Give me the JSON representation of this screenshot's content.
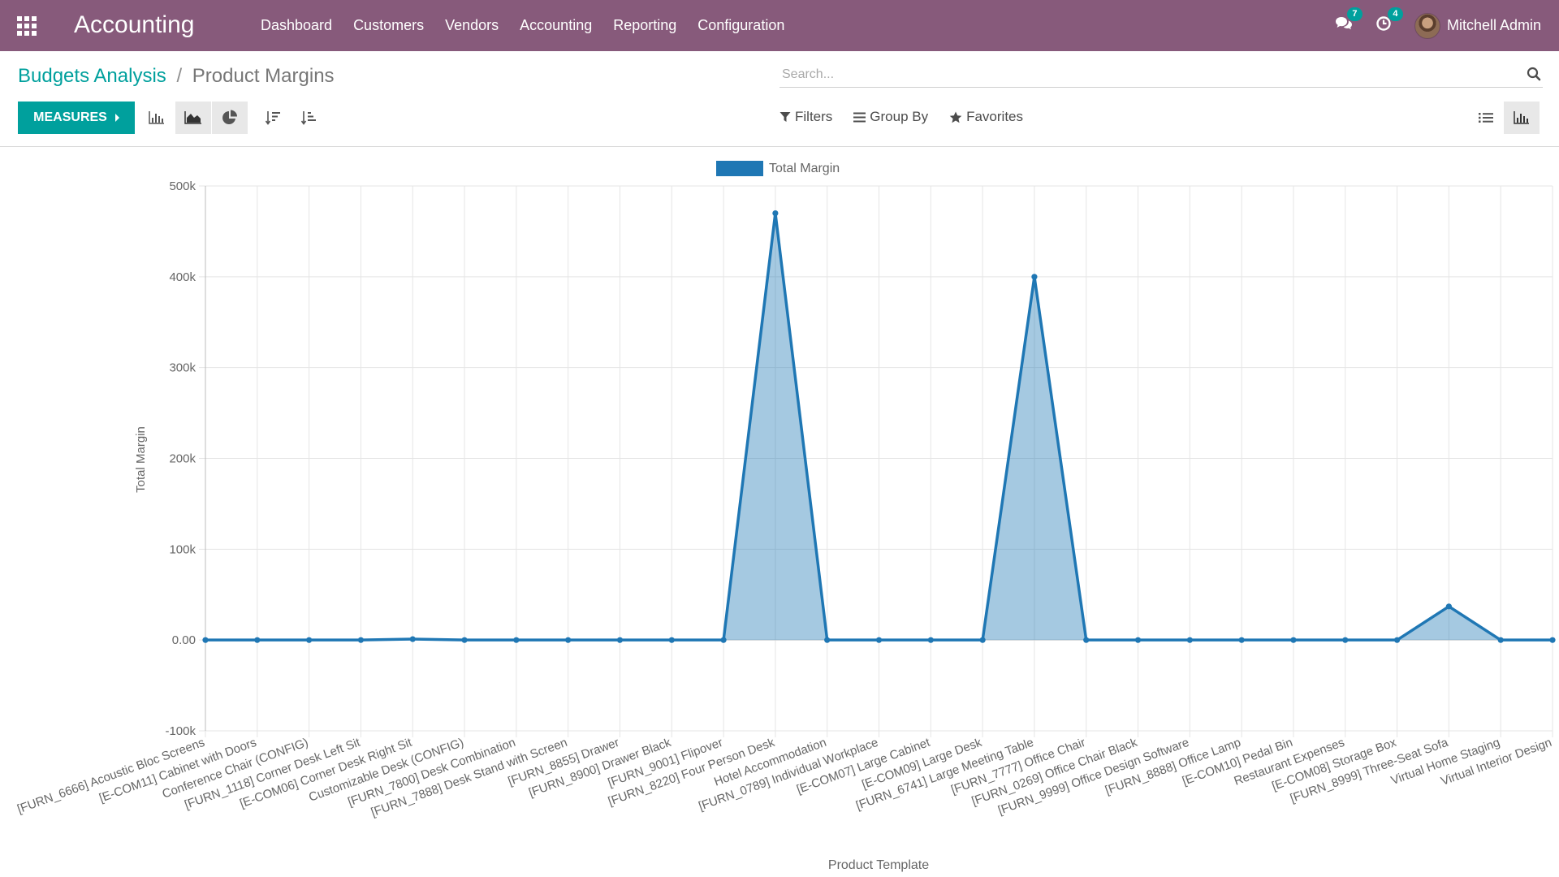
{
  "navbar": {
    "app_title": "Accounting",
    "menu": [
      "Dashboard",
      "Customers",
      "Vendors",
      "Accounting",
      "Reporting",
      "Configuration"
    ],
    "messages_count": "7",
    "activities_count": "4",
    "user_name": "Mitchell Admin"
  },
  "breadcrumb": {
    "parent": "Budgets Analysis",
    "separator": "/",
    "current": "Product Margins"
  },
  "search": {
    "placeholder": "Search..."
  },
  "toolbar": {
    "measures_label": "MEASURES"
  },
  "filters": {
    "filters_label": "Filters",
    "group_by_label": "Group By",
    "favorites_label": "Favorites"
  },
  "colors": {
    "navbar": "#875a7b",
    "accent": "#00a09d",
    "series": "#1f77b4"
  },
  "chart_data": {
    "type": "area",
    "legend": [
      "Total Margin"
    ],
    "legend_position": "top-center",
    "xlabel": "Product Template",
    "ylabel": "Total Margin",
    "ylim": [
      -100000,
      500000
    ],
    "yticks": [
      "-100k",
      "0.00",
      "100k",
      "200k",
      "300k",
      "400k",
      "500k"
    ],
    "ytick_values": [
      -100000,
      0,
      100000,
      200000,
      300000,
      400000,
      500000
    ],
    "grid": true,
    "categories": [
      "[FURN_6666] Acoustic Bloc Screens",
      "[E-COM11] Cabinet with Doors",
      "Conference Chair (CONFIG)",
      "[FURN_1118] Corner Desk Left Sit",
      "[E-COM06] Corner Desk Right Sit",
      "Customizable Desk (CONFIG)",
      "[FURN_7800] Desk Combination",
      "[FURN_7888] Desk Stand with Screen",
      "[FURN_8855] Drawer",
      "[FURN_8900] Drawer Black",
      "[FURN_9001] Flipover",
      "[FURN_8220] Four Person Desk",
      "Hotel Accommodation",
      "[FURN_0789] Individual Workplace",
      "[E-COM07] Large Cabinet",
      "[E-COM09] Large Desk",
      "[FURN_6741] Large Meeting Table",
      "[FURN_7777] Office Chair",
      "[FURN_0269] Office Chair Black",
      "[FURN_9999] Office Design Software",
      "[FURN_8888] Office Lamp",
      "[E-COM10] Pedal Bin",
      "Restaurant Expenses",
      "[E-COM08] Storage Box",
      "[FURN_8999] Three-Seat Sofa",
      "Virtual Home Staging",
      "Virtual Interior Design"
    ],
    "series": [
      {
        "name": "Total Margin",
        "values": [
          0,
          0,
          0,
          0,
          1000,
          0,
          0,
          0,
          0,
          0,
          0,
          470000,
          0,
          0,
          0,
          0,
          400000,
          0,
          0,
          0,
          0,
          0,
          0,
          0,
          37000,
          0,
          0
        ]
      }
    ]
  }
}
